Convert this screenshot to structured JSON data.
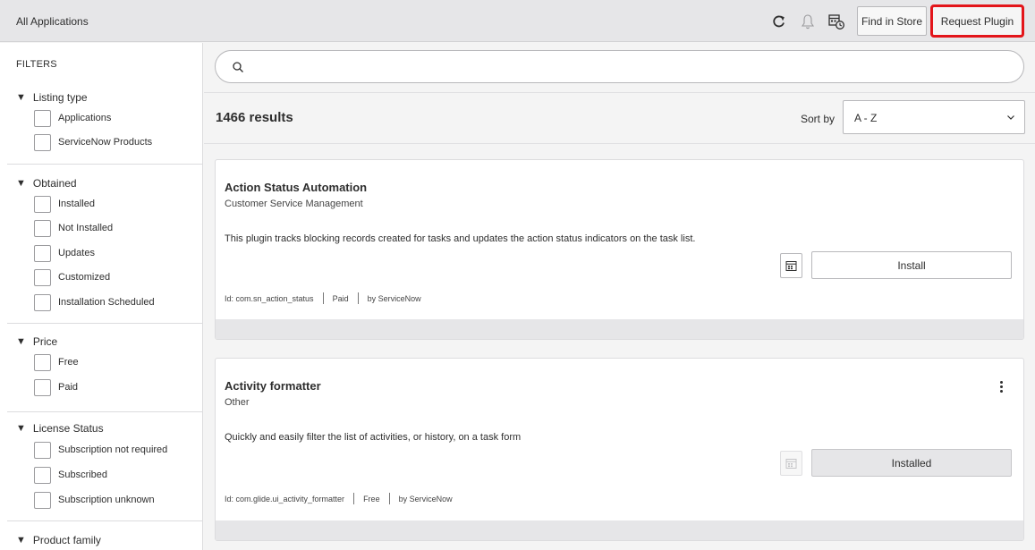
{
  "header": {
    "title": "All Applications",
    "find_in_store": "Find in Store",
    "request_plugin": "Request Plugin",
    "icons": [
      "refresh-icon",
      "bell-icon",
      "calendar-clock-icon"
    ]
  },
  "sidebar": {
    "title": "FILTERS",
    "groups": [
      {
        "label": "Listing type",
        "options": [
          "Applications",
          "ServiceNow Products"
        ]
      },
      {
        "label": "Obtained",
        "options": [
          "Installed",
          "Not Installed",
          "Updates",
          "Customized",
          "Installation Scheduled"
        ]
      },
      {
        "label": "Price",
        "options": [
          "Free",
          "Paid"
        ]
      },
      {
        "label": "License Status",
        "options": [
          "Subscription not required",
          "Subscribed",
          "Subscription unknown"
        ]
      },
      {
        "label": "Product family",
        "options": []
      }
    ]
  },
  "search": {
    "value": "",
    "placeholder": ""
  },
  "results": {
    "count_text": "1466 results",
    "sort_label": "Sort by",
    "sort_value": "A - Z"
  },
  "cards": [
    {
      "title": "Action Status Automation",
      "subtitle": "Customer Service Management",
      "description": "This plugin tracks blocking records created for tasks and updates the action status indicators on the task list.",
      "id_text": "Id: com.sn_action_status",
      "price": "Paid",
      "vendor": "by ServiceNow",
      "action": "Install"
    },
    {
      "title": "Activity formatter",
      "subtitle": "Other",
      "description": "Quickly and easily filter the list of activities, or history, on a task form",
      "id_text": "Id: com.glide.ui_activity_formatter",
      "price": "Free",
      "vendor": "by ServiceNow",
      "action": "Installed"
    }
  ],
  "colors": {
    "header_bg": "#e6e6e8",
    "highlight": "#e3151a",
    "page_bg": "#f4f4f4"
  }
}
